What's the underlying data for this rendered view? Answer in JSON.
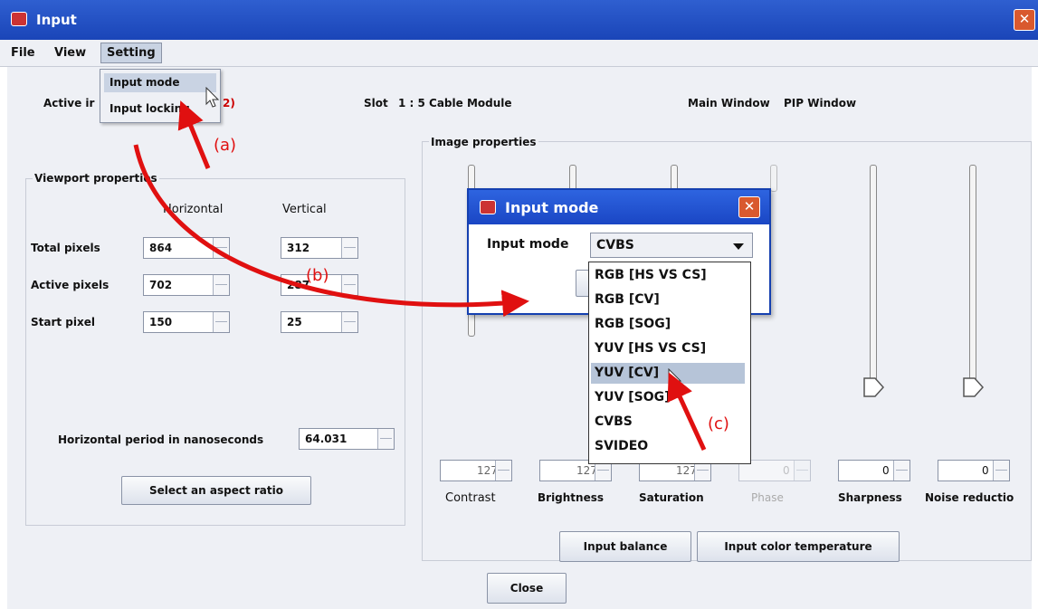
{
  "window": {
    "title": "Input",
    "close_glyph": "✕"
  },
  "menubar": {
    "items": [
      "File",
      "View",
      "Setting"
    ]
  },
  "setting_menu": {
    "items": [
      "Input mode",
      "Input locking"
    ]
  },
  "header": {
    "active_input_label": "Active ir",
    "active_input_suffix": "2)",
    "slot_label": "Slot",
    "slot_value": "1 : 5 Cable Module",
    "main_window": "Main Window",
    "pip_window": "PIP Window"
  },
  "viewport": {
    "title": "Viewport properties",
    "col_horizontal": "Horizontal",
    "col_vertical": "Vertical",
    "rows": [
      {
        "label": "Total pixels",
        "h": "864",
        "v": "312"
      },
      {
        "label": "Active pixels",
        "h": "702",
        "v": "287"
      },
      {
        "label": "Start pixel",
        "h": "150",
        "v": "25"
      }
    ],
    "period_label": "Horizontal period in nanoseconds",
    "period_value": "64.031",
    "aspect_button": "Select an aspect ratio"
  },
  "image": {
    "title": "Image properties",
    "controls": [
      {
        "label": "Contrast",
        "value": "127",
        "enabled": true
      },
      {
        "label": "Brightness",
        "value": "127",
        "enabled": true
      },
      {
        "label": "Saturation",
        "value": "127",
        "enabled": true
      },
      {
        "label": "Phase",
        "value": "0",
        "enabled": false
      },
      {
        "label": "Sharpness",
        "value": "0",
        "enabled": true
      },
      {
        "label": "Noise reductio",
        "value": "0",
        "enabled": true
      }
    ],
    "balance_button": "Input balance",
    "temperature_button": "Input color temperature"
  },
  "footer": {
    "close_button": "Close"
  },
  "dialog": {
    "title": "Input mode",
    "close_glyph": "✕",
    "field_label": "Input mode",
    "selected": "CVBS",
    "options": [
      "RGB [HS VS CS]",
      "RGB [CV]",
      "RGB [SOG]",
      "YUV [HS VS CS]",
      "YUV [CV]",
      "YUV [SOG]",
      "CVBS",
      "SVIDEO"
    ],
    "highlighted_index": 4
  },
  "annotations": {
    "a": "(a)",
    "b": "(b)",
    "c": "(c)"
  },
  "colors": {
    "title_bar": "#1a45b8",
    "annotation": "#e01010",
    "panel": "#eef0f5"
  },
  "icons": [
    "app-icon",
    "close-icon",
    "cursor-icon",
    "chevron-down-icon",
    "red-arrow"
  ]
}
